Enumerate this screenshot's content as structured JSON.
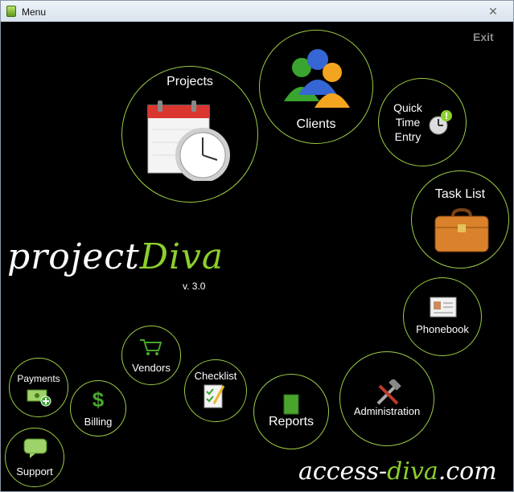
{
  "window": {
    "title": "Menu",
    "close_glyph": "✕"
  },
  "exit_label": "Exit",
  "menu": {
    "projects": "Projects",
    "clients": "Clients",
    "quick_line1": "Quick",
    "quick_line2": "Time",
    "quick_line3": "Entry",
    "task_list": "Task List",
    "phonebook": "Phonebook",
    "administration": "Administration",
    "reports": "Reports",
    "checklist": "Checklist",
    "vendors": "Vendors",
    "billing": "Billing",
    "billing_glyph": "$",
    "payments": "Payments",
    "support": "Support"
  },
  "brand": {
    "name_part1": "project",
    "name_part2": "Diva",
    "version": "v. 3.0",
    "footer_part1": "access-",
    "footer_part2": "diva",
    "footer_part3": ".com"
  },
  "colors": {
    "accent": "#9bcc44",
    "background": "#000000",
    "brand_green": "#8ccf2c"
  },
  "icons": [
    "calendar-clock-icon",
    "people-icon",
    "clock-alert-icon",
    "briefcase-icon",
    "contact-card-icon",
    "tools-icon",
    "book-icon",
    "checklist-icon",
    "shopping-cart-icon",
    "dollar-icon",
    "money-icon",
    "chat-bubble-icon"
  ]
}
